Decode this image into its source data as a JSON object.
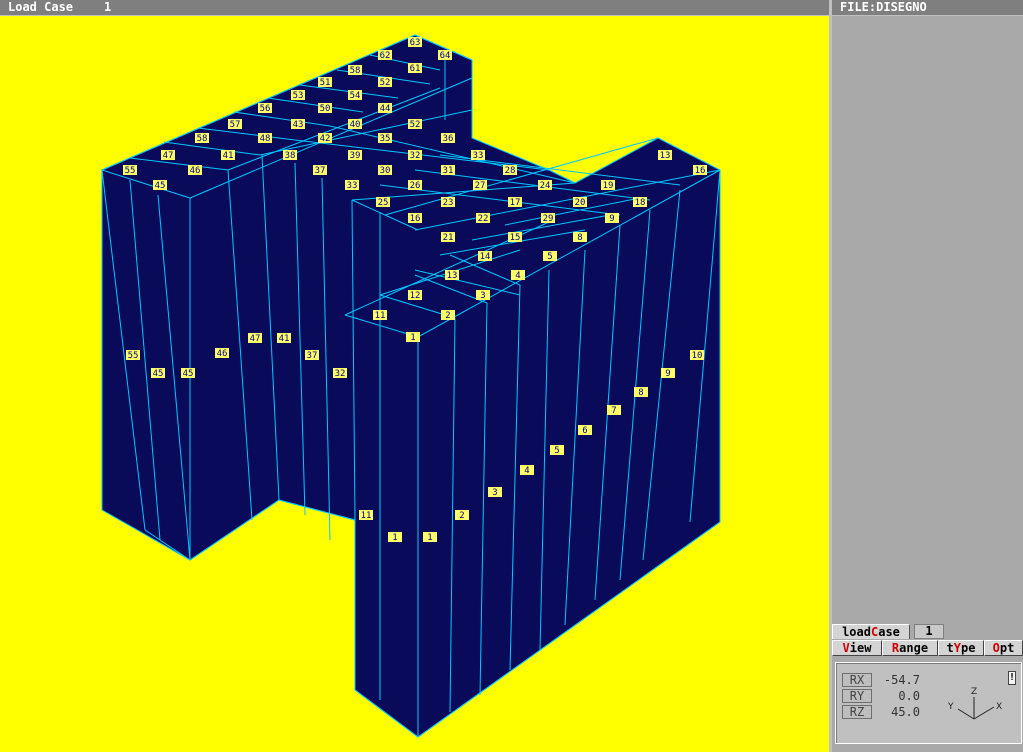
{
  "title_bar": {
    "label": "Load Case",
    "value": "1"
  },
  "file_bar": {
    "label": "FILE:DISEGNO"
  },
  "load_case": {
    "label_pre": "load",
    "label_hot": "C",
    "label_post": "ase",
    "value": "1"
  },
  "menu": [
    {
      "hot": "V",
      "rest": "iew",
      "pre": ""
    },
    {
      "hot": "R",
      "rest": "ange",
      "pre": ""
    },
    {
      "pre": "t",
      "hot": "Y",
      "rest": "pe"
    },
    {
      "hot": "O",
      "rest": "pt",
      "pre": ""
    }
  ],
  "rotation": {
    "rx": {
      "label": "RX",
      "value": "-54.7"
    },
    "ry": {
      "label": "RY",
      "value": "0.0"
    },
    "rz": {
      "label": "RZ",
      "value": "45.0"
    }
  },
  "axes": {
    "x": "X",
    "y": "Y",
    "z": "Z"
  },
  "marker": "!",
  "colors": {
    "background": "#ffff00",
    "structure": "#0a0a5a",
    "edges": "#00c8ff",
    "labels": "#ffff66"
  },
  "top_labels": [
    "63",
    "64",
    "62",
    "58",
    "61",
    "52",
    "51",
    "54",
    "53",
    "50",
    "44",
    "56",
    "57",
    "43",
    "40",
    "52",
    "58",
    "48",
    "42",
    "35",
    "36",
    "47",
    "41",
    "38",
    "39",
    "32",
    "33",
    "55",
    "45",
    "46",
    "37",
    "33",
    "30",
    "31",
    "27",
    "28",
    "24",
    "20",
    "19",
    "25",
    "26",
    "23",
    "17",
    "18",
    "13",
    "16",
    "29",
    "22",
    "16",
    "9",
    "21",
    "15",
    "8",
    "14",
    "5",
    "13",
    "4",
    "12",
    "3",
    "11",
    "2",
    "1"
  ],
  "face_labels": [
    "55",
    "45",
    "45",
    "46",
    "47",
    "41",
    "37",
    "32",
    "11",
    "1",
    "1",
    "2",
    "3",
    "4",
    "5",
    "6",
    "7",
    "8",
    "9",
    "10"
  ]
}
